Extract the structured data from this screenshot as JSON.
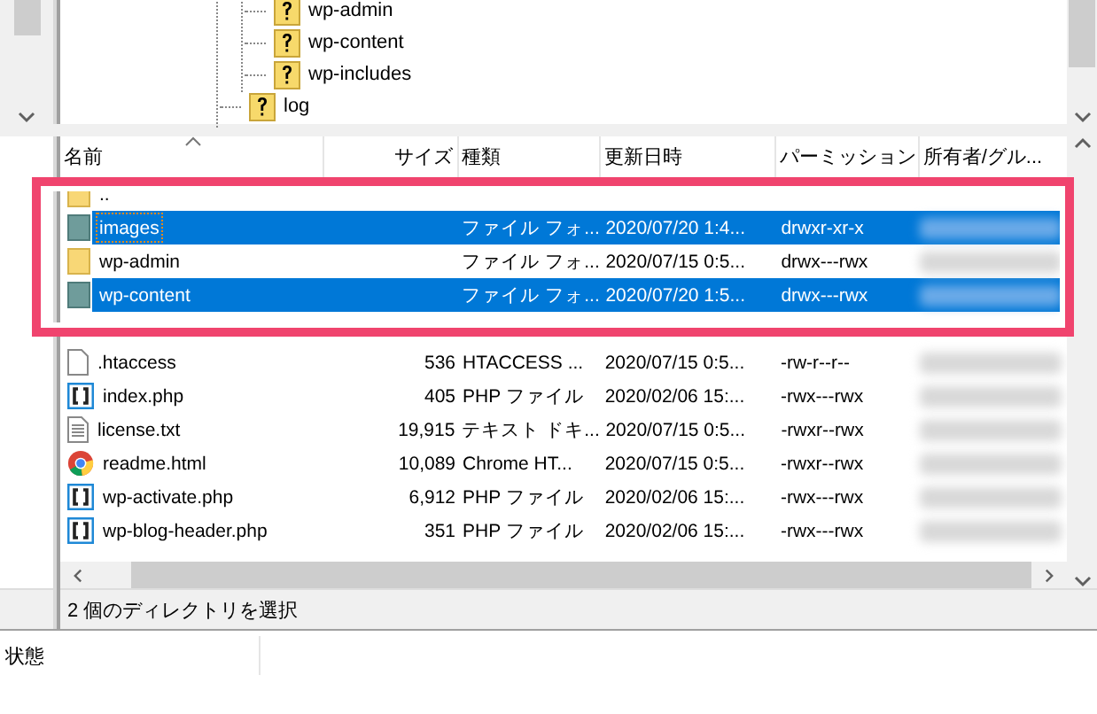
{
  "tree": {
    "nodes": [
      {
        "children": [
          {
            "label": "wp-admin"
          },
          {
            "label": "wp-content"
          },
          {
            "label": "wp-includes"
          }
        ]
      },
      {
        "label": "log"
      }
    ]
  },
  "file_list": {
    "columns": [
      {
        "label": "名前",
        "sorted": true
      },
      {
        "label": "サイズ",
        "sorted": false
      },
      {
        "label": "種類",
        "sorted": false
      },
      {
        "label": "更新日時",
        "sorted": false
      },
      {
        "label": "パーミッション",
        "sorted": false
      },
      {
        "label": "所有者/グル..."
      }
    ],
    "rows": [
      {
        "kind": "up",
        "name": "..",
        "selected": false
      },
      {
        "kind": "folder",
        "name": "images",
        "type": "ファイル フォ...",
        "modified": "2020/07/20 1:4...",
        "permissions": "drwxr-xr-x",
        "selected": true,
        "focused": true
      },
      {
        "kind": "folder",
        "name": "wp-admin",
        "type": "ファイル フォ...",
        "modified": "2020/07/15 0:5...",
        "permissions": "drwx---rwx",
        "selected": false,
        "focused": false
      },
      {
        "kind": "folder",
        "name": "wp-content",
        "type": "ファイル フォ...",
        "modified": "2020/07/20 1:5...",
        "permissions": "drwx---rwx",
        "selected": true,
        "focused": false
      },
      {
        "kind": "hidden"
      },
      {
        "kind": "blank",
        "name": ".htaccess",
        "size": "536",
        "type": "HTACCESS ...",
        "modified": "2020/07/15 0:5...",
        "permissions": "-rw-r--r--",
        "selected": false,
        "focused": false
      },
      {
        "kind": "php",
        "name": "index.php",
        "size": "405",
        "type": "PHP ファイル",
        "modified": "2020/02/06 15:...",
        "permissions": "-rwx---rwx",
        "selected": false,
        "focused": false
      },
      {
        "kind": "text",
        "name": "license.txt",
        "size": "19,915",
        "type": "テキスト ドキ...",
        "modified": "2020/07/15 0:5...",
        "permissions": "-rwxr--rwx",
        "selected": false,
        "focused": false
      },
      {
        "kind": "browser",
        "name": "readme.html",
        "size": "10,089",
        "type": "Chrome HT...",
        "modified": "2020/07/15 0:5...",
        "permissions": "-rwxr--rwx",
        "selected": false,
        "focused": false
      },
      {
        "kind": "php",
        "name": "wp-activate.php",
        "size": "6,912",
        "type": "PHP ファイル",
        "modified": "2020/02/06 15:...",
        "permissions": "-rwx---rwx",
        "selected": false,
        "focused": false
      },
      {
        "kind": "php",
        "name": "wp-blog-header.php",
        "size": "351",
        "type": "PHP ファイル",
        "modified": "2020/02/06 15:...",
        "permissions": "-rwx---rwx",
        "selected": false,
        "focused": false
      }
    ]
  },
  "status_line": "2 個のディレクトリを選択",
  "queue": {
    "column": "状態"
  }
}
